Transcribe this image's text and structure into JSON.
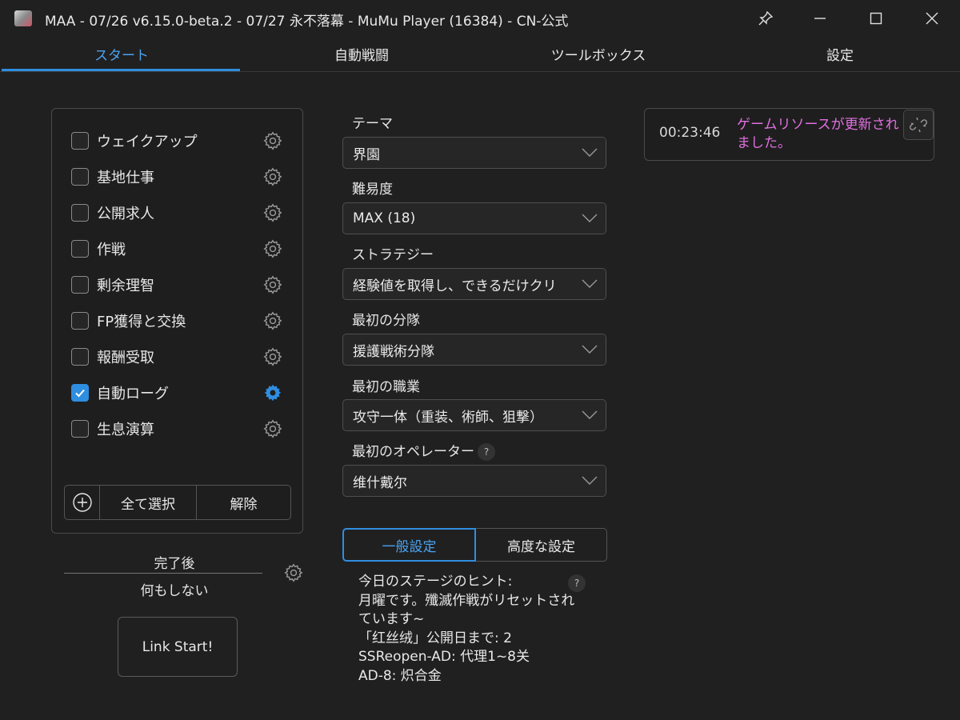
{
  "window": {
    "title": "MAA - 07/26 v6.15.0-beta.2 - 07/27 永不落幕 - MuMu Player (16384) - CN-公式"
  },
  "tabs": [
    {
      "label": "スタート",
      "active": true
    },
    {
      "label": "自動戦闘",
      "active": false
    },
    {
      "label": "ツールボックス",
      "active": false
    },
    {
      "label": "設定",
      "active": false
    }
  ],
  "tasks": [
    {
      "label": "ウェイクアップ",
      "checked": false
    },
    {
      "label": "基地仕事",
      "checked": false
    },
    {
      "label": "公開求人",
      "checked": false
    },
    {
      "label": "作戦",
      "checked": false
    },
    {
      "label": "剰余理智",
      "checked": false
    },
    {
      "label": "FP獲得と交換",
      "checked": false
    },
    {
      "label": "報酬受取",
      "checked": false
    },
    {
      "label": "自動ローグ",
      "checked": true
    },
    {
      "label": "生息演算",
      "checked": false
    }
  ],
  "task_buttons": {
    "select_all": "全て選択",
    "clear": "解除"
  },
  "after": {
    "label": "完了後",
    "value": "何もしない"
  },
  "link_start": "Link Start!",
  "settings": {
    "theme": {
      "label": "テーマ",
      "value": "界園"
    },
    "difficulty": {
      "label": "難易度",
      "value": "MAX (18)"
    },
    "strategy": {
      "label": "ストラテジー",
      "value": "経験値を取得し、できるだけクリ"
    },
    "squad": {
      "label": "最初の分隊",
      "value": "援護戦術分隊"
    },
    "roles": {
      "label": "最初の職業",
      "value": "攻守一体（重装、術師、狙撃）"
    },
    "operator": {
      "label": "最初のオペレーター",
      "value": "维什戴尔"
    }
  },
  "help_mark": "?",
  "mode_tabs": {
    "general": "一般設定",
    "advanced": "高度な設定"
  },
  "hints": [
    "今日のステージのヒント:",
    "月曜です。殲滅作戦がリセットされ",
    "ています~",
    "「红丝绒」公開日まで: 2",
    "SSReopen-AD: 代理1~8关",
    "AD-8: 炽合金"
  ],
  "log": {
    "time": "00:23:46",
    "message": "ゲームリソースが更新されました。",
    "message_color": "#e070e0"
  },
  "colors": {
    "accent": "#2f8ee0",
    "background": "#202020"
  }
}
